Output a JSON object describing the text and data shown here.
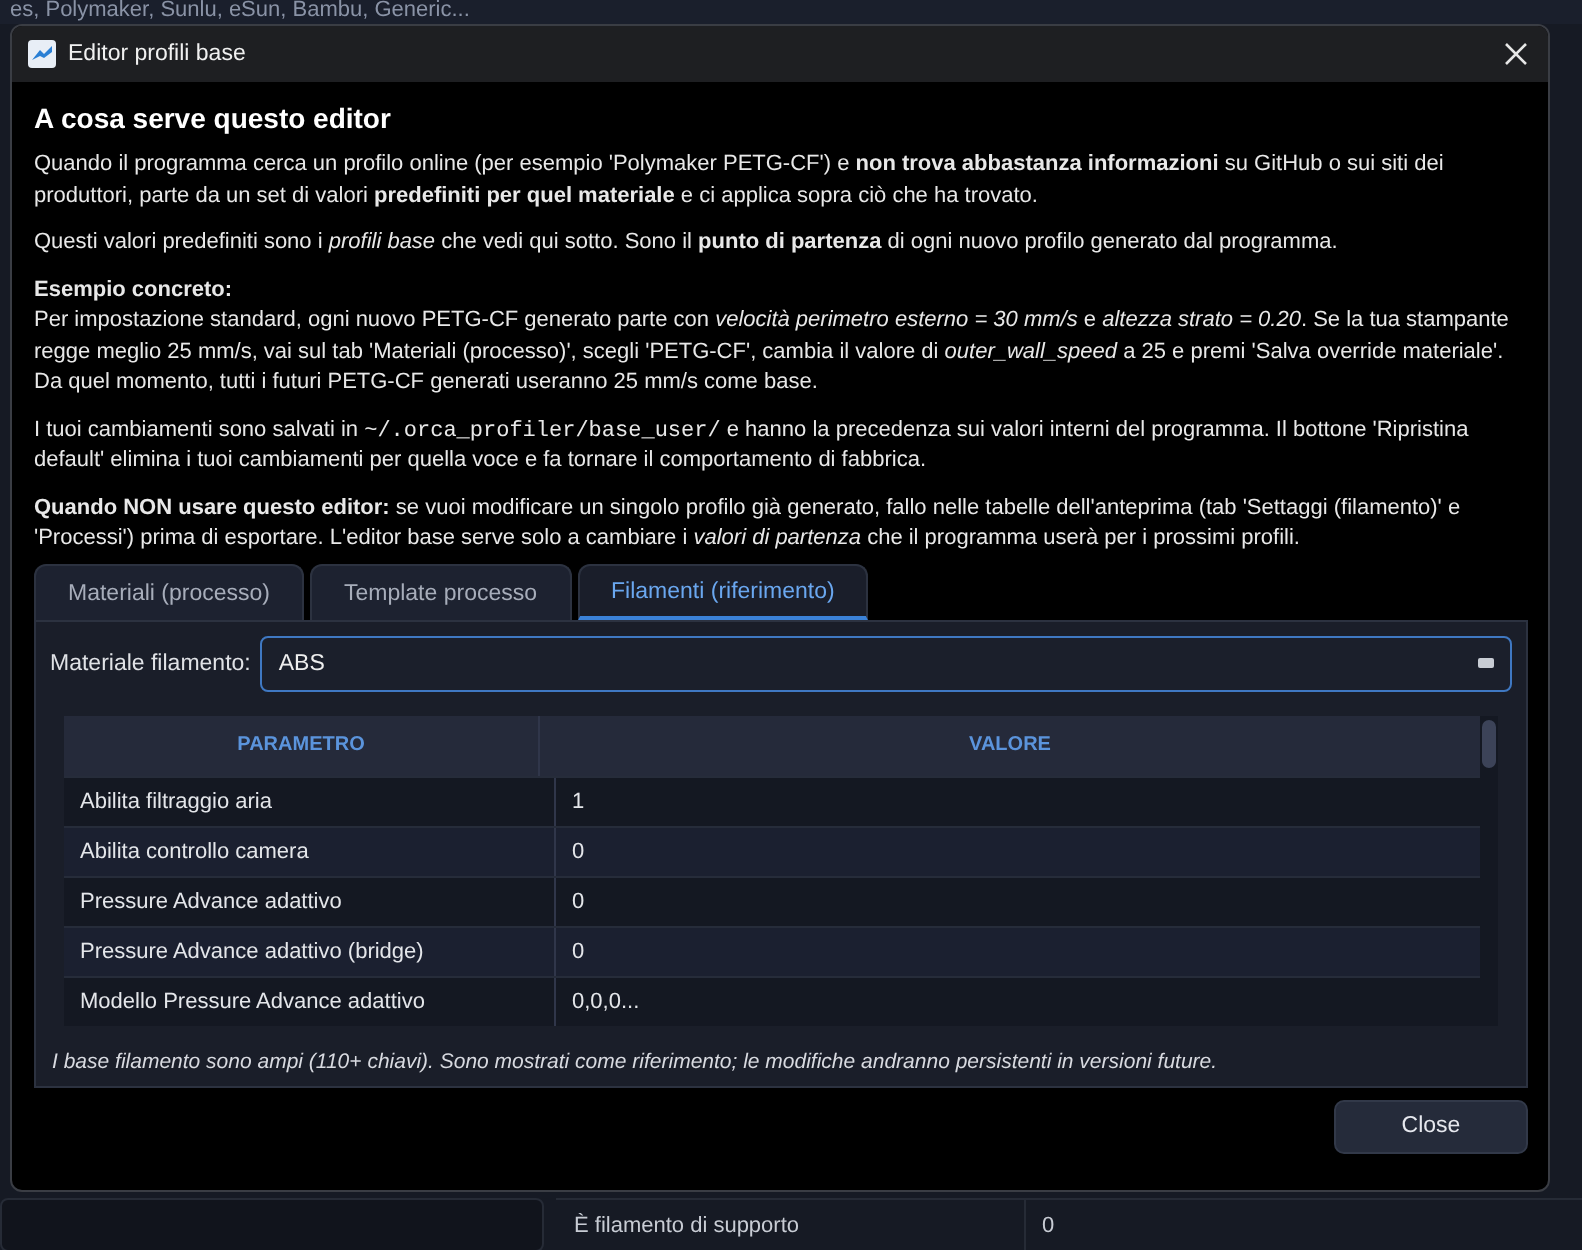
{
  "background": {
    "top_text": "es, Polymaker, Sunlu, eSun, Bambu, Generic...",
    "bottom_row": {
      "name": "È filamento di supporto",
      "value": "0"
    }
  },
  "window": {
    "title": "Editor profili base"
  },
  "heading": "A cosa serve questo editor",
  "paragraphs": [
    [
      {
        "kind": "text",
        "text": "Quando il programma cerca un profilo online (per esempio 'Polymaker PETG-CF') e **non trova abbastanza informazioni** su GitHub o sui siti dei produttori, parte da un set di valori **predefiniti per quel materiale** e ci applica sopra ciò che ha trovato."
      }
    ],
    [
      {
        "kind": "text",
        "text": "Questi valori predefiniti sono i *profili base* che vedi qui sotto. Sono il **punto di partenza** di ogni nuovo profilo generato dal programma."
      }
    ],
    [
      {
        "kind": "text",
        "text": "**Esempio concreto:**"
      },
      {
        "kind": "break"
      },
      {
        "kind": "text",
        "text": "Per impostazione standard, ogni nuovo PETG-CF generato parte con *velocità perimetro esterno = 30 mm/s* e *altezza strato = 0.20*. Se la tua stampante regge meglio 25 mm/s, vai sul tab 'Materiali (processo)', scegli 'PETG-CF', cambia il valore di *outer_wall_speed* a 25 e premi 'Salva override materiale'. Da quel momento, tutti i futuri PETG-CF generati useranno 25 mm/s come base."
      }
    ],
    [
      {
        "kind": "text",
        "text": "I tuoi cambiamenti sono salvati in "
      },
      {
        "kind": "code",
        "text": "~/.orca_profiler/base_user/"
      },
      {
        "kind": "text",
        "text": " e hanno la precedenza sui valori interni del programma. Il bottone 'Ripristina default' elimina i tuoi cambiamenti per quella voce e fa tornare il comportamento di fabbrica."
      }
    ],
    [
      {
        "kind": "text",
        "text": "**Quando NON usare questo editor:** se vuoi modificare un singolo profilo già generato, fallo nelle tabelle dell'anteprima (tab 'Settaggi (filamento)' e 'Processi') prima di esportare. L'editor base serve solo a cambiare i *valori di partenza* che il programma userà per i prossimi profili."
      }
    ]
  ],
  "tabs": [
    {
      "label": "Materiali (processo)",
      "selected": false
    },
    {
      "label": "Template processo",
      "selected": false
    },
    {
      "label": "Filamenti (riferimento)",
      "selected": true
    }
  ],
  "material": {
    "label": "Materiale filamento:",
    "value": "ABS"
  },
  "table": {
    "columns": [
      "PARAMETRO",
      "VALORE"
    ],
    "rows": [
      {
        "name": "Abilita filtraggio aria",
        "value": "1"
      },
      {
        "name": "Abilita controllo camera",
        "value": "0"
      },
      {
        "name": "Pressure Advance adattivo",
        "value": "0"
      },
      {
        "name": "Pressure Advance adattivo (bridge)",
        "value": "0"
      },
      {
        "name": "Modello Pressure Advance adattivo",
        "value": "0,0,0..."
      }
    ]
  },
  "note": "I base filamento sono ampi (110+ chiavi). Sono mostrati come riferimento; le modifiche andranno persistenti in versioni future.",
  "buttons": [
    "Close"
  ]
}
